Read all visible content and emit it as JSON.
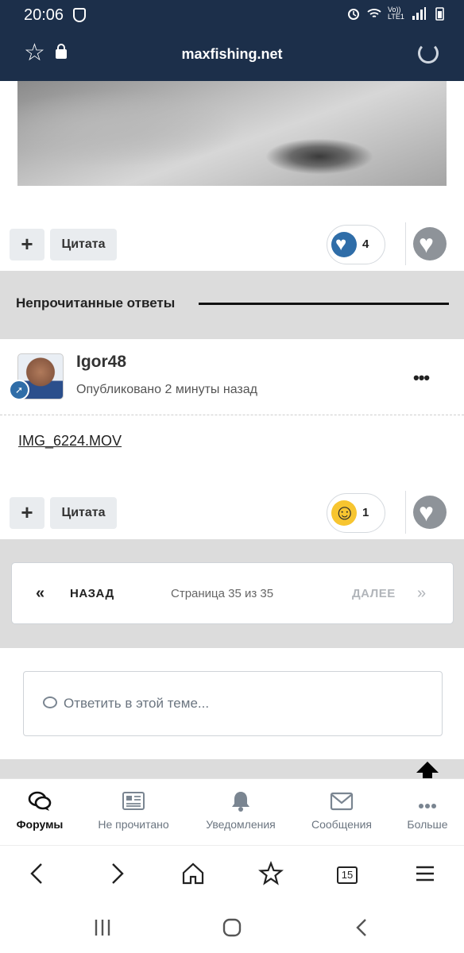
{
  "status_bar": {
    "time": "20:06",
    "network": "Vo)) LTE1"
  },
  "browser": {
    "domain": "maxfishing.net"
  },
  "post1": {
    "add_label": "+",
    "quote_label": "Цитата",
    "reaction_count": "4",
    "reaction_type": "heart"
  },
  "section": {
    "title": "Непрочитанные ответы"
  },
  "post2": {
    "author": "Igor48",
    "published": "Опубликовано 2 минуты назад",
    "more_label": "•••",
    "attachment": "IMG_6224.MOV",
    "add_label": "+",
    "quote_label": "Цитата",
    "reaction_count": "1",
    "reaction_type": "laugh"
  },
  "pagination": {
    "prev_arrow": "«",
    "prev_label": "НАЗАД",
    "page_info": "Страница 35 из 35",
    "next_label": "ДАЛЕЕ",
    "next_arrow": "»"
  },
  "reply": {
    "placeholder": "Ответить в этой теме..."
  },
  "bottom_nav": {
    "items": [
      {
        "label": "Форумы",
        "icon": "chat-bubbles-icon",
        "active": true
      },
      {
        "label": "Не прочитано",
        "icon": "newspaper-icon",
        "active": false
      },
      {
        "label": "Уведомления",
        "icon": "bell-icon",
        "active": false
      },
      {
        "label": "Сообщения",
        "icon": "envelope-icon",
        "active": false
      },
      {
        "label": "Больше",
        "icon": "more-icon",
        "active": false
      }
    ]
  },
  "browser_toolbar": {
    "tab_count": "15"
  },
  "colors": {
    "header_bg": "#1c2f4a",
    "accent_blue": "#2f6da8",
    "band_grey": "#dcdcdc"
  }
}
